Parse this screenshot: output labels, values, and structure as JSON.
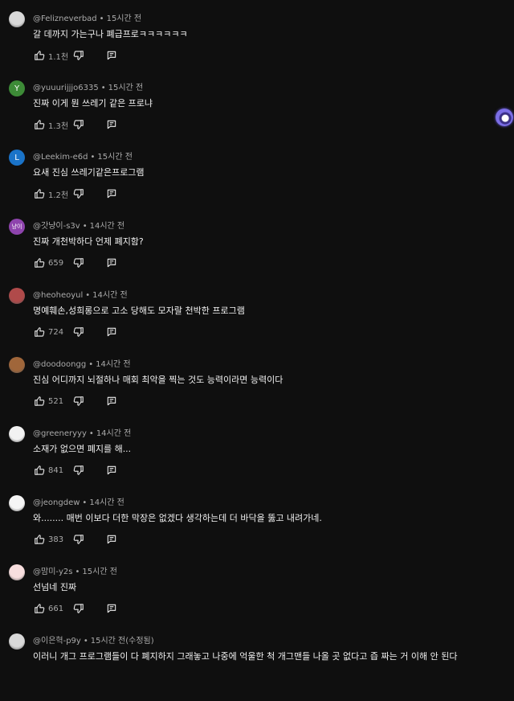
{
  "comments": [
    {
      "handle": "@Felizneverbad",
      "time": "15시간 전",
      "text": "갈 데까지 가는구나 폐급프로ㅋㅋㅋㅋㅋㅋ",
      "likes": "1.1천",
      "avatar": {
        "type": "image",
        "initial": "",
        "color": "#d8d8d8"
      }
    },
    {
      "handle": "@yuuurijjjo6335",
      "time": "15시간 전",
      "text": "진짜 이게 뭔 쓰레기 같은 프로냐",
      "likes": "1.3천",
      "avatar": {
        "type": "letter",
        "initial": "Y",
        "color": "#3d8b37"
      }
    },
    {
      "handle": "@Leekim-e6d",
      "time": "15시간 전",
      "text": "요새 진심 쓰레기같은프로그램",
      "likes": "1.2천",
      "avatar": {
        "type": "letter",
        "initial": "L",
        "color": "#1a73c8"
      }
    },
    {
      "handle": "@갓냥이-s3v",
      "time": "14시간 전",
      "text": "진짜 개천박하다 언제 폐지함?",
      "likes": "659",
      "avatar": {
        "type": "letter",
        "initial": "냥이",
        "color": "#8e44ad"
      }
    },
    {
      "handle": "@heoheoyul",
      "time": "14시간 전",
      "text": "명예훼손,성희롱으로 고소 당해도 모자랄 천박한 프로그램",
      "likes": "724",
      "avatar": {
        "type": "image",
        "initial": "",
        "color": "#b04a4a"
      }
    },
    {
      "handle": "@doodoongg",
      "time": "14시간 전",
      "text": "진심 어디까지 뇌절하나 매회 최악을 찍는 것도 능력이라면 능력이다",
      "likes": "521",
      "avatar": {
        "type": "image",
        "initial": "",
        "color": "#a0663a"
      }
    },
    {
      "handle": "@greeneryyy",
      "time": "14시간 전",
      "text": "소재가 없으면 폐지를 해...",
      "likes": "841",
      "avatar": {
        "type": "image",
        "initial": "",
        "color": "#f2f2f2"
      }
    },
    {
      "handle": "@jeongdew",
      "time": "14시간 전",
      "text": "와........ 매번 이보다 더한 막장은 없겠다 생각하는데 더 바닥을 뚫고 내려가네.",
      "likes": "383",
      "avatar": {
        "type": "image",
        "initial": "",
        "color": "#f5f5f5"
      }
    },
    {
      "handle": "@맘미-y2s",
      "time": "15시간 전",
      "text": "선넘네 진짜",
      "likes": "661",
      "avatar": {
        "type": "image",
        "initial": "",
        "color": "#f7dede"
      }
    },
    {
      "handle": "@이은혁-p9y",
      "time": "15시간 전(수정됨)",
      "text": "이러니 개그 프로그램들이 다 폐지하지 그래놓고 나중에 억울한 척 개그맨들 나올 곳 없다고 즙 짜는 거 이해 안 된다",
      "likes": "",
      "avatar": {
        "type": "image",
        "initial": "",
        "color": "#d9d9d9"
      }
    }
  ],
  "icons": {
    "like": "thumb-up-icon",
    "dislike": "thumb-down-icon",
    "reply": "reply-icon"
  },
  "colors": {
    "background": "#0f0f0f",
    "text": "#f1f1f1",
    "secondary": "#aaaaaa"
  }
}
